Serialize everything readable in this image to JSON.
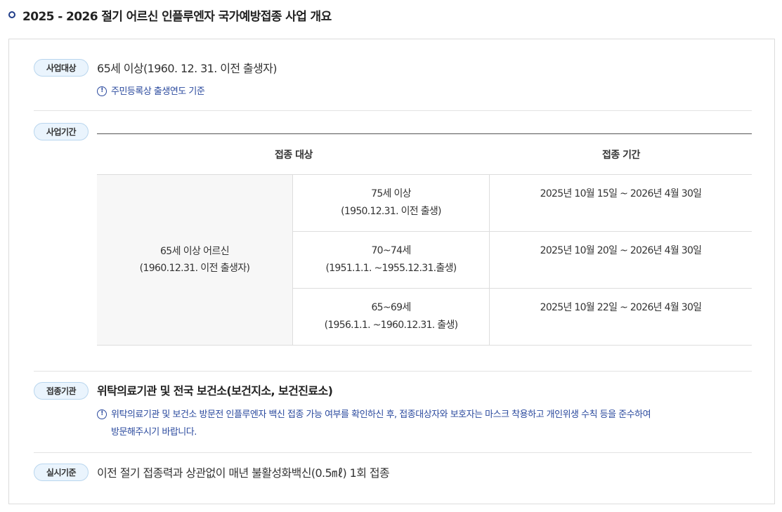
{
  "page_title": "2025 - 2026 절기 어르신 인플루엔자 국가예방접종 사업 개요",
  "colors": {
    "accent": "#1f3c88",
    "badge_bg": "#eaf4fd",
    "badge_border": "#b9d6ee",
    "note": "#2b4a9e"
  },
  "sections": {
    "target": {
      "badge": "사업대상",
      "text": "65세 이상(1960. 12. 31. 이전 출생자)",
      "note_icon": "info-circle-icon",
      "note": "주민등록상 출생연도 기준"
    },
    "period": {
      "badge": "사업기간",
      "table": {
        "headers": [
          "접종 대상",
          "접종 기간"
        ],
        "group_label_line1": "65세 이상 어르신",
        "group_label_line2": "(1960.12.31. 이전 출생자)",
        "rows": [
          {
            "target_line1": "75세 이상",
            "target_line2": "(1950.12.31. 이전 출생)",
            "period": "2025년 10월 15일 ~ 2026년 4월 30일"
          },
          {
            "target_line1": "70~74세",
            "target_line2": "(1951.1.1. ~1955.12.31.출생)",
            "period": "2025년 10월 20일 ~ 2026년 4월 30일"
          },
          {
            "target_line1": "65~69세",
            "target_line2": "(1956.1.1. ~1960.12.31. 출생)",
            "period": "2025년 10월 22일 ~ 2026년 4월 30일"
          }
        ]
      }
    },
    "institution": {
      "badge": "접종기관",
      "text": "위탁의료기관 및 전국 보건소(보건지소, 보건진료소)",
      "note_icon": "info-circle-icon",
      "note_line1": "위탁의료기관 및 보건소 방문전 인플루엔자 백신 접종 가능 여부를 확인하신 후, 접종대상자와 보호자는 마스크 착용하고 개인위생 수칙 등을 준수하여",
      "note_line2": "방문해주시기 바랍니다."
    },
    "criteria": {
      "badge": "실시기준",
      "text": "이전 절기 접종력과 상관없이 매년 불활성화백신(0.5㎖) 1회 접종"
    }
  }
}
